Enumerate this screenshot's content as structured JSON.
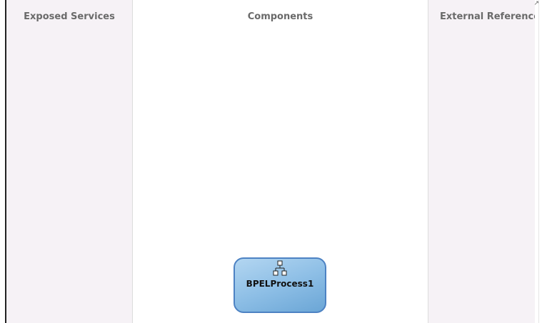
{
  "lanes": {
    "exposed_services": {
      "title": "Exposed Services"
    },
    "components": {
      "title": "Components"
    },
    "external_references": {
      "title": "External Reference"
    }
  },
  "component": {
    "label": "BPELProcess1",
    "icon": "bpel-process-icon"
  },
  "colors": {
    "lane_background": "#f6f2f6",
    "header_text": "#6a6a6a",
    "component_border": "#4d82c3",
    "component_fill": "#8ebfe6"
  }
}
